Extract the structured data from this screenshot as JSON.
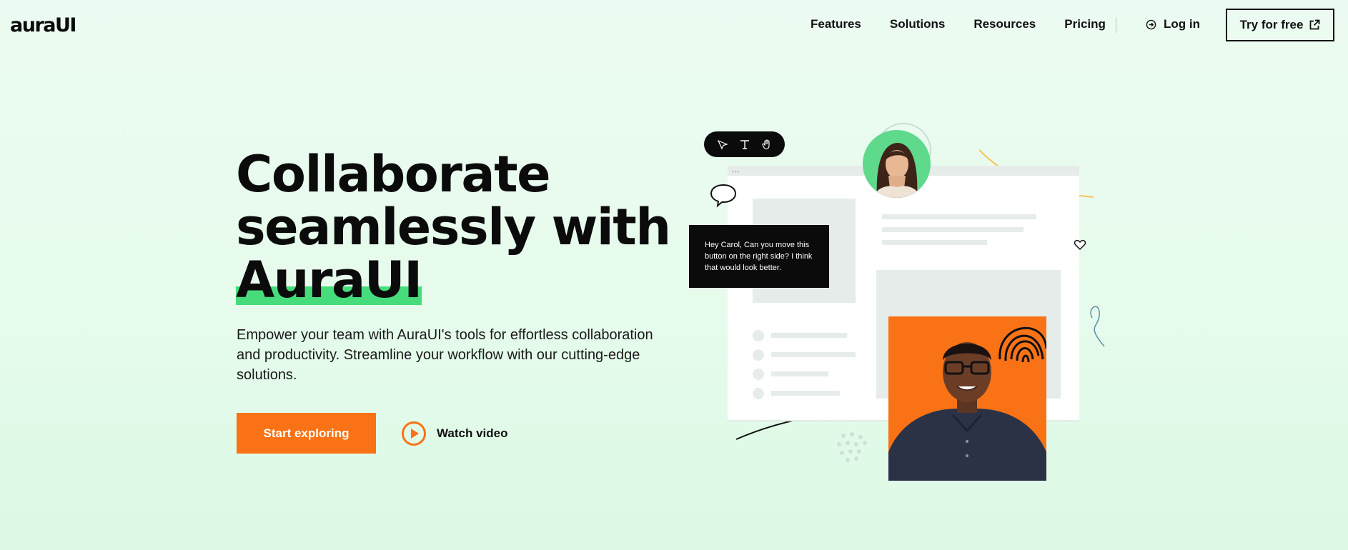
{
  "brand": {
    "logo": "auraUI"
  },
  "nav": {
    "links": [
      "Features",
      "Solutions",
      "Resources",
      "Pricing"
    ],
    "login": "Log in",
    "cta": "Try for free"
  },
  "hero": {
    "title_line1": "Collaborate",
    "title_line2": "seamlessly with",
    "title_highlight": "AuraUI",
    "subtitle": "Empower your team with AuraUI's tools for effortless collaboration and productivity. Streamline your workflow with our cutting-edge solutions.",
    "primary_button": "Start exploring",
    "secondary_button": "Watch video"
  },
  "illustration": {
    "chat_message": "Hey Carol, Can you move this button on the right side? I think that would look better.",
    "toolbar_icons": [
      "cursor-icon",
      "text-icon",
      "hand-icon"
    ]
  },
  "colors": {
    "accent": "#f97316",
    "highlight": "#47dc7b",
    "background": "#e6fbec",
    "ink": "#0b0b0b"
  }
}
